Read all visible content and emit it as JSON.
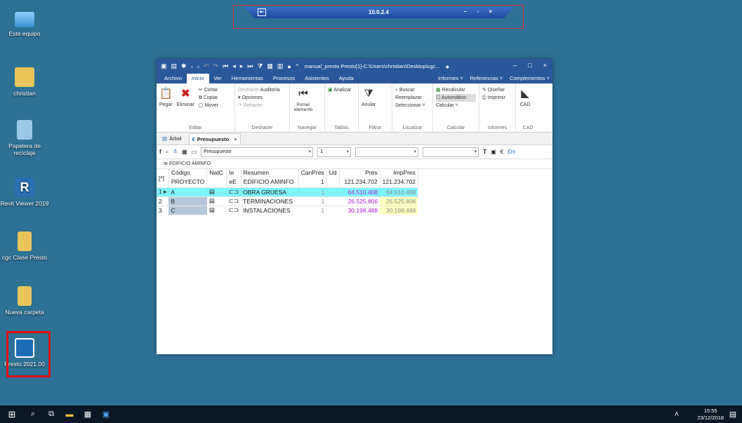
{
  "desktop": {
    "icons": [
      {
        "label": "Este equipo",
        "icon": "pc-icon",
        "color": "#6fb6e8"
      },
      {
        "label": "christian",
        "icon": "user-folder-icon",
        "color": "#e8c45a"
      },
      {
        "label": "Papelera de reciclaje",
        "icon": "recycle-bin-icon",
        "color": "#9cc8e6"
      },
      {
        "label": "Revit Viewer 2019",
        "icon": "revit-icon",
        "color": "#2a6fb0"
      },
      {
        "label": "cgc Clase Presto",
        "icon": "folder-icon",
        "color": "#e8c45a"
      },
      {
        "label": "Nueva carpeta",
        "icon": "folder-icon",
        "color": "#e8c45a"
      },
      {
        "label": "Presto 2021.00",
        "icon": "presto-icon",
        "color": "#1d6cb8"
      }
    ]
  },
  "remote_bar": {
    "ip": "10.0.2.4",
    "pin": "⇤",
    "controls": "– ▫ ×"
  },
  "window": {
    "title": "manual_presto Presto[1]-C:\\Users\\christian\\Desktop\\cgc...",
    "controls": {
      "minimize": "–",
      "maximize": "□",
      "close": "×"
    },
    "menu": [
      "Archivo",
      "Inicio",
      "Ver",
      "Herramientas",
      "Procesos",
      "Asistentes",
      "Ayuda"
    ],
    "menu_right": [
      "Informes ˅",
      "Referencias ˅",
      "Complementos ˅"
    ],
    "ribbon": {
      "editar": {
        "name": "Editar",
        "pegar": "Pegar",
        "eliminar": "Eliminar",
        "cortar": "Cortar",
        "copiar": "Copiar",
        "mover": "Mover"
      },
      "deshacer": {
        "name": "Deshacer",
        "deshacer": "Deshacer",
        "auditoria": "Auditoría",
        "opciones": "Opciones",
        "rehacer": "Rehacer"
      },
      "navegar": {
        "name": "Navegar",
        "primer": "Primer elemento"
      },
      "tablas": {
        "name": "Tablas",
        "analizar": "Analizar"
      },
      "filtrar": {
        "name": "Filtrar",
        "anular": "Anular"
      },
      "localizar": {
        "name": "Localizar",
        "buscar": "Buscar",
        "reemplazar": "Reemplazar",
        "seleccionar": "Seleccionar ˅"
      },
      "calcular": {
        "name": "Calcular",
        "recalcular": "Recalcular",
        "automatico": "Automático",
        "calcular": "Calcular ˅"
      },
      "informes": {
        "name": "Informes",
        "disenar": "Diseñar",
        "imprimir": "Imprimir"
      },
      "cad": {
        "name": "CAD",
        "cad": "CAD"
      }
    },
    "tabs": {
      "arbol": "Árbol",
      "presupuesto": "Presupuesto",
      "close": "×"
    },
    "toolbar": {
      "view": "Presupuesto",
      "level": "1"
    },
    "path": "EDIFICIO AMINFO",
    "table": {
      "header_flag": "[*]",
      "headers": [
        "Código",
        "NatC",
        "Ie",
        "Resumen",
        "CanPres",
        "Ud",
        "Pres",
        "ImpPres"
      ],
      "root": {
        "codigo": "PROYECTO",
        "ie": "eE",
        "resumen": "EDIFICIO AMINFO",
        "canpres": "1",
        "pres": "121.234.702",
        "imppres": "121.234.702"
      },
      "rows": [
        {
          "n": "1",
          "codigo": "A",
          "resumen": "OBRA GRUESA",
          "canpres": "1",
          "pres": "64.510.408",
          "imppres": "64.510.408"
        },
        {
          "n": "2",
          "codigo": "B",
          "resumen": "TERMINACIONES",
          "canpres": "1",
          "pres": "26.525.806",
          "imppres": "26.525.806"
        },
        {
          "n": "3",
          "codigo": "C",
          "resumen": "INSTALACIONES",
          "canpres": "1",
          "pres": "30.198.488",
          "imppres": "30.198.488"
        }
      ]
    }
  },
  "taskbar": {
    "time": "15:55",
    "date": "23/12/2018"
  }
}
